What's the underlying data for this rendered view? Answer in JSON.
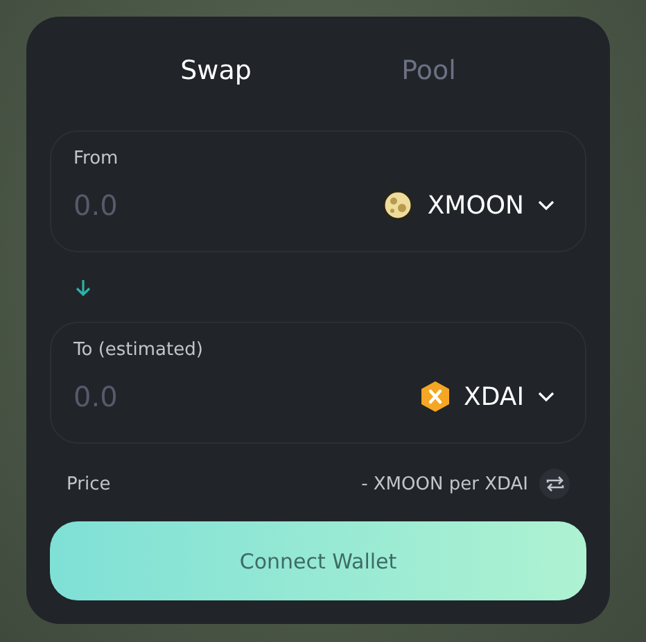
{
  "tabs": [
    {
      "label": "Swap",
      "selected": true
    },
    {
      "label": "Pool",
      "selected": false
    }
  ],
  "from": {
    "label": "From",
    "placeholder": "0.0",
    "token": {
      "symbol": "XMOON",
      "kind": "moon"
    }
  },
  "to": {
    "label": "To (estimated)",
    "placeholder": "0.0",
    "token": {
      "symbol": "XDAI",
      "kind": "hex"
    }
  },
  "price": {
    "label": "Price",
    "value": "- XMOON per XDAI"
  },
  "button": "Connect Wallet"
}
